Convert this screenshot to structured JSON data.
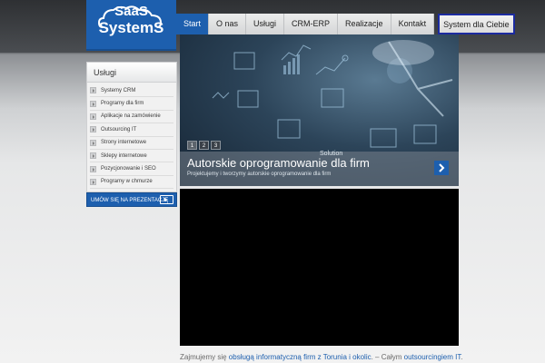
{
  "logo": {
    "line1": "SaaS",
    "line2": "SystemS"
  },
  "nav": {
    "items": [
      {
        "label": "Start"
      },
      {
        "label": "O nas"
      },
      {
        "label": "Usługi"
      },
      {
        "label": "CRM-ERP"
      },
      {
        "label": "Realizacje"
      },
      {
        "label": "Kontakt"
      },
      {
        "label": "System dla Ciebie"
      }
    ]
  },
  "sidebar": {
    "title": "Usługi",
    "items": [
      {
        "label": "Systemy CRM"
      },
      {
        "label": "Programy dla firm"
      },
      {
        "label": "Aplikacje na zamówienie"
      },
      {
        "label": "Outsourcing IT"
      },
      {
        "label": "Strony internetowe"
      },
      {
        "label": "Sklepy internetowe"
      },
      {
        "label": "Pozycjonowanie i SEO"
      },
      {
        "label": "Programy w chmurze"
      }
    ]
  },
  "cta": {
    "label": "UMÓW SIĘ NA PREZENTACJĘ",
    "icon": "presentation-screen-icon"
  },
  "slider": {
    "title": "Autorskie oprogramowanie dla firm",
    "subtitle": "Projektujemy i tworzymy autorskie oprogramowanie dla firm",
    "overlay_text": "Solution",
    "pages": [
      "1",
      "2",
      "3"
    ],
    "active_page": "1",
    "next_icon": "chevron-right-icon"
  },
  "intro": {
    "prefix": "Zajmujemy się ",
    "link1": "obsługą informatyczną firm z Torunia i okolic",
    "middle": ". – Całym ",
    "link2": "outsourcingiem IT",
    "suffix": "."
  },
  "colors": {
    "brand": "#1d5fae",
    "nav_highlight_border": "#1c2ba0"
  }
}
